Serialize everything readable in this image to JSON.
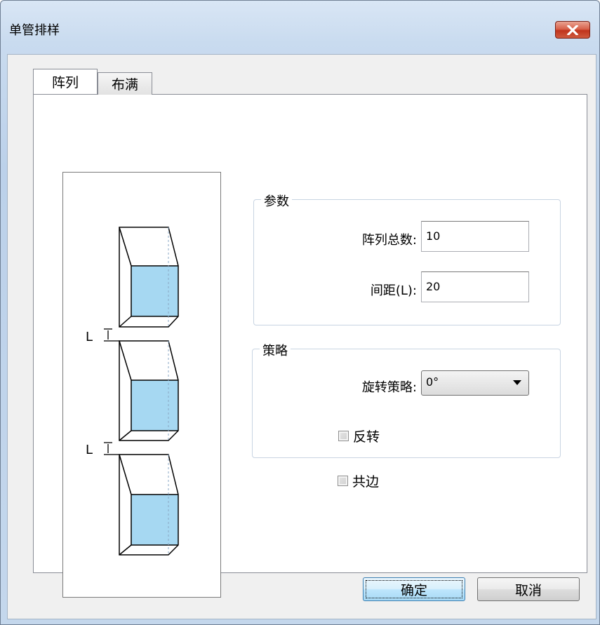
{
  "window": {
    "title": "单管排样",
    "close_icon": "close-icon"
  },
  "tabs": [
    {
      "label": "阵列",
      "active": true
    },
    {
      "label": "布满",
      "active": false
    }
  ],
  "illustration": {
    "spacing_label_1": "L",
    "spacing_label_2": "L",
    "fill_color": "#a6d8f2"
  },
  "params_group": {
    "title": "参数",
    "array_total_label": "阵列总数:",
    "array_total_value": "10",
    "spacing_label": "间距(L):",
    "spacing_value": "20"
  },
  "strategy_group": {
    "title": "策略",
    "rotate_label": "旋转策略:",
    "rotate_value": "0°",
    "reverse_label": "反转",
    "reverse_checked": false
  },
  "shared_edge": {
    "label": "共边",
    "checked": false
  },
  "buttons": {
    "ok": "确定",
    "cancel": "取消"
  }
}
